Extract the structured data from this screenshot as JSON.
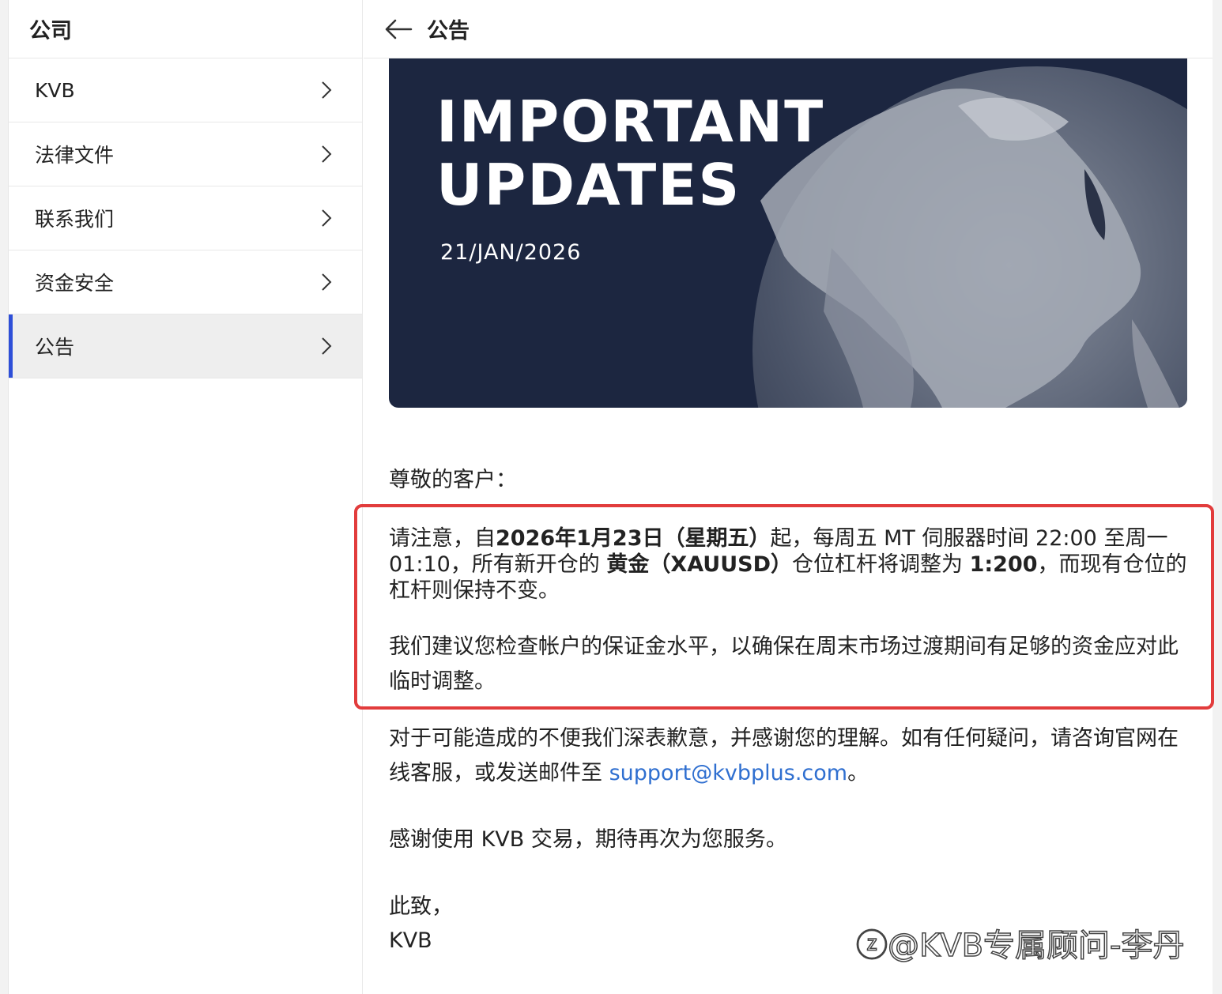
{
  "sidebar": {
    "title": "公司",
    "items": [
      {
        "label": "KVB"
      },
      {
        "label": "法律文件"
      },
      {
        "label": "联系我们"
      },
      {
        "label": "资金安全"
      },
      {
        "label": "公告"
      }
    ]
  },
  "main": {
    "title": "公告",
    "banner": {
      "title_line1": "IMPORTANT",
      "title_line2": "UPDATES",
      "date": "21/JAN/2026"
    },
    "greeting": "尊敬的客户：",
    "para1": {
      "t1": "请注意，自",
      "b1": "2026年1月23日（星期五）",
      "t2": "起，每周五 MT 伺服器时间 22:00 至周一 01:10，所有新开仓的 ",
      "b2": "黄金（XAUUSD）",
      "t3": "仓位杠杆将调整为 ",
      "b3": "1:200",
      "t4": "，而现有仓位的杠杆则保持不变。"
    },
    "para2": "我们建议您检查帐户的保证金水平，以确保在周末市场过渡期间有足够的资金应对此临时调整。",
    "para3": {
      "text": "对于可能造成的不便我们深表歉意，并感谢您的理解。如有任何疑问，请咨询官网在线客服，或发送邮件至 ",
      "email": "support@kvbplus.com",
      "end": "。"
    },
    "para4": "感谢使用 KVB 交易，期待再次为您服务。",
    "sign_line1": "此致，",
    "sign_line2": "KVB"
  },
  "watermark": "@KVB专属顾问-李丹",
  "colors": {
    "accent": "#2e4fd8",
    "highlight_border": "#e23c3c",
    "link": "#2f6fd0",
    "banner_bg": "#1c2640"
  },
  "icons": {
    "back": "arrow-left-icon",
    "chevron": "chevron-right-icon",
    "watermark_logo": "zhihu-logo-icon"
  }
}
